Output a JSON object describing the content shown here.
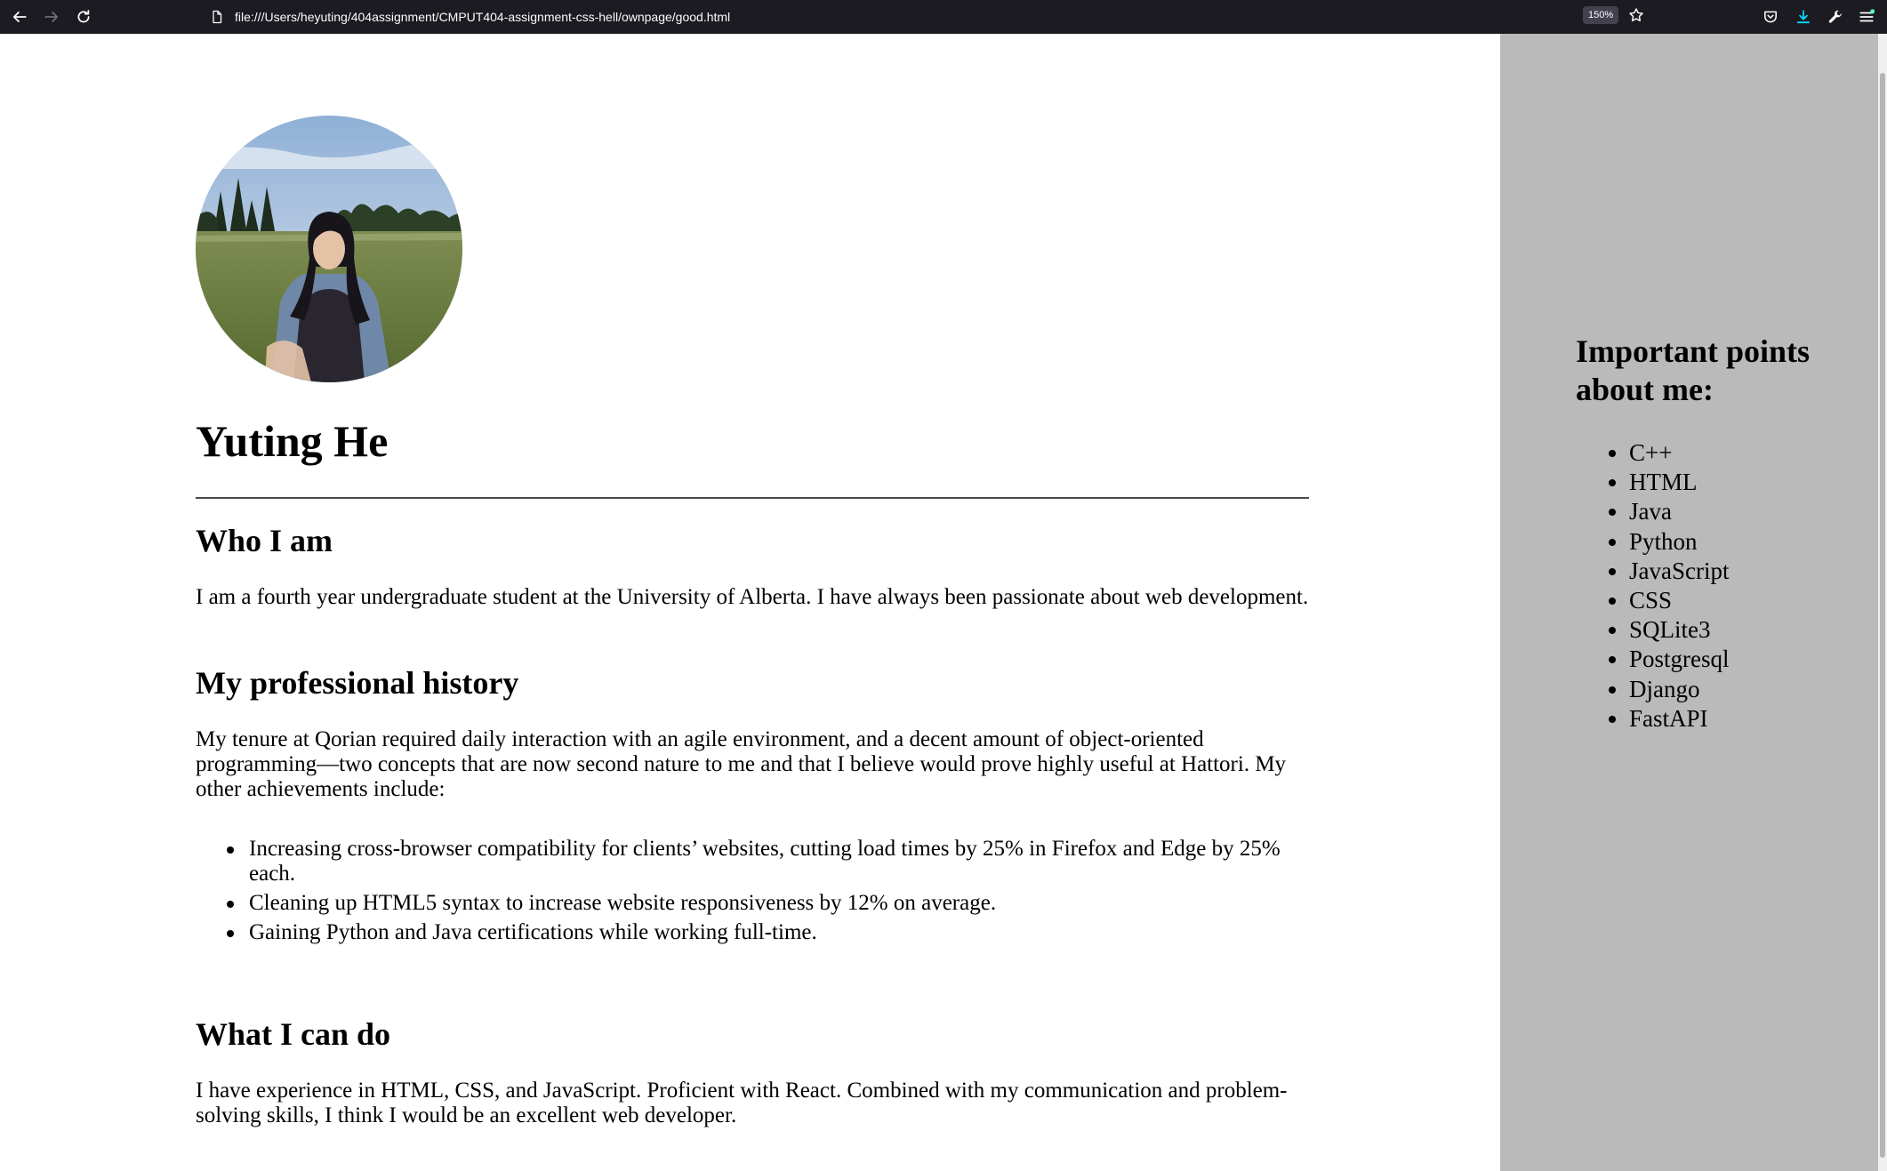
{
  "browser": {
    "url": "file:///Users/heyuting/404assignment/CMPUT404-assignment-css-hell/ownpage/good.html",
    "zoom": "150%",
    "icons": [
      "back-arrow-icon",
      "forward-arrow-icon",
      "reload-icon",
      "page-icon",
      "bookmark-star-icon",
      "pocket-icon",
      "download-icon",
      "wrench-icon",
      "menu-icon"
    ],
    "colors": {
      "toolbar": "#1c1b22",
      "download_accent": "#00ddff",
      "notification_dot": "#54ffbd"
    }
  },
  "profile": {
    "name": "Yuting He",
    "avatar_icon": "profile-photo"
  },
  "sections": {
    "who": {
      "heading": "Who I am",
      "text": "I am a fourth year undergraduate student at the University of Alberta. I have always been passionate about web development."
    },
    "history": {
      "heading": "My professional history",
      "text": "My tenure at Qorian required daily interaction with an agile environment, and a decent amount of object-oriented programming—two concepts that are now second nature to me and that I believe would prove highly useful at Hattori. My other achievements include:",
      "achievements": [
        "Increasing cross-browser compatibility for clients’ websites, cutting load times by 25% in Firefox and Edge by 25% each.",
        "Cleaning up HTML5 syntax to increase website responsiveness by 12% on average.",
        "Gaining Python and Java certifications while working full-time."
      ]
    },
    "skills": {
      "heading": "What I can do",
      "text": "I have experience in HTML, CSS, and JavaScript. Proficient with React. Combined with my communication and problem-solving skills, I think I would be an excellent web developer."
    }
  },
  "sidebar": {
    "title": "Important points about me:",
    "items": [
      "C++",
      "HTML",
      "Java",
      "Python",
      "JavaScript",
      "CSS",
      "SQLite3",
      "Postgresql",
      "Django",
      "FastAPI"
    ],
    "background": "#bababa"
  }
}
